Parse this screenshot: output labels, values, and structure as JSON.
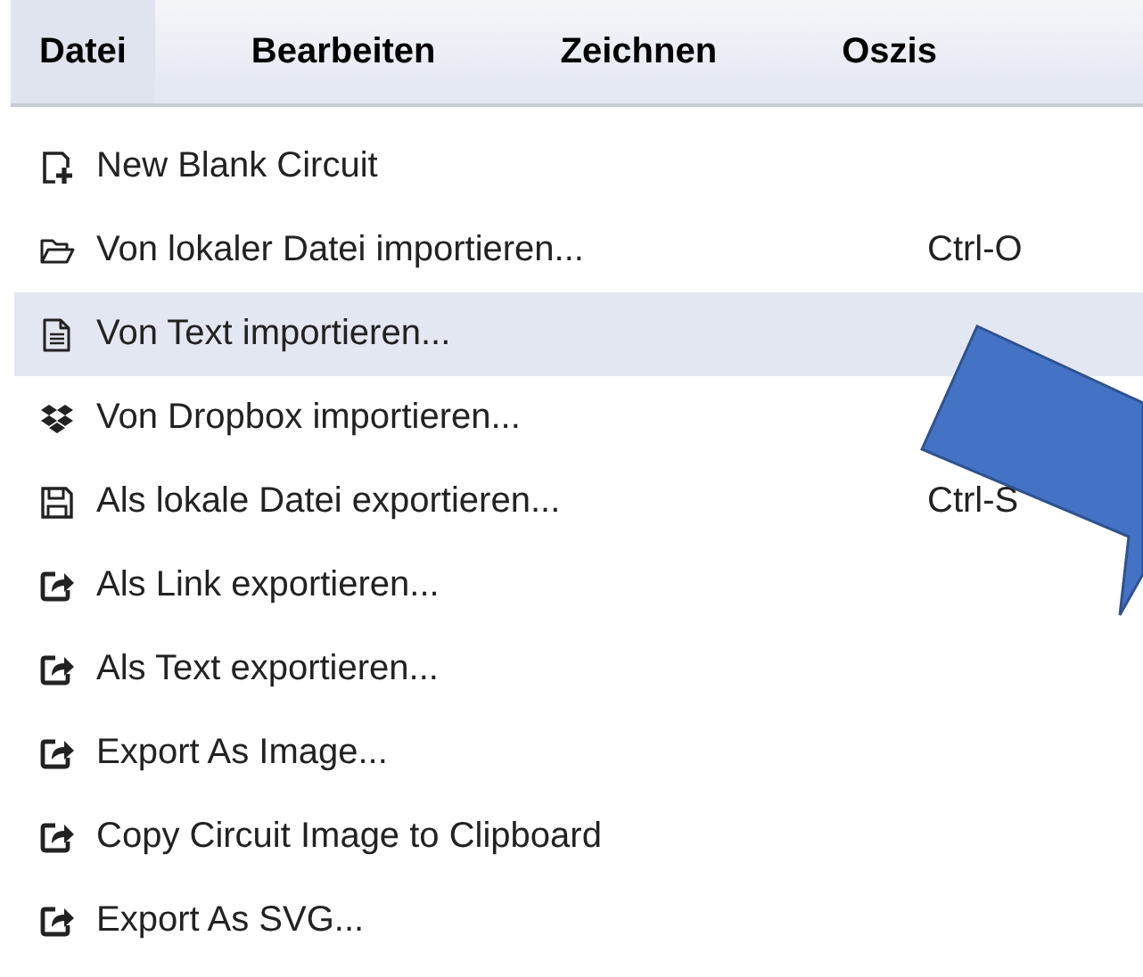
{
  "menubar": [
    {
      "label": "Datei",
      "selected": true
    },
    {
      "label": "Bearbeiten",
      "selected": false
    },
    {
      "label": "Zeichnen",
      "selected": false
    },
    {
      "label": "Oszis",
      "selected": false
    }
  ],
  "menu_items": [
    {
      "kind": "new",
      "label": "New Blank Circuit",
      "selected": false
    },
    {
      "kind": "open",
      "label": "Von lokaler Datei importieren...",
      "shortcut": "Ctrl-O",
      "selected": false
    },
    {
      "kind": "text",
      "label": "Von Text importieren...",
      "selected": true
    },
    {
      "kind": "dropbox",
      "label": "Von Dropbox importieren...",
      "selected": false
    },
    {
      "kind": "save",
      "label": "Als lokale Datei exportieren...",
      "shortcut": "Ctrl-S",
      "selected": false
    },
    {
      "kind": "share",
      "label": "Als Link exportieren...",
      "selected": false
    },
    {
      "kind": "share",
      "label": "Als Text exportieren...",
      "selected": false
    },
    {
      "kind": "share",
      "label": "Export As Image...",
      "selected": false
    },
    {
      "kind": "share",
      "label": "Copy Circuit Image to Clipboard",
      "selected": false
    },
    {
      "kind": "share",
      "label": "Export As SVG...",
      "selected": false
    }
  ]
}
